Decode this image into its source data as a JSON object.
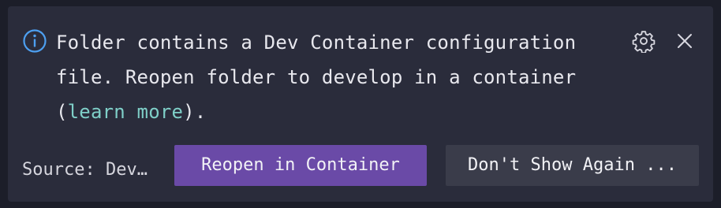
{
  "notification": {
    "message_before_link": "Folder contains a Dev Container configuration file. Reopen folder to develop in a container (",
    "link_text": "learn more",
    "message_after_link": ").",
    "source_label": "Source: Dev…",
    "primary_button_label": "Reopen in Container",
    "secondary_button_label": "Don't Show Again ...",
    "icons": {
      "info": "info-icon",
      "settings": "gear-icon",
      "close": "close-icon"
    }
  },
  "colors": {
    "background": "#1c1e29",
    "panel": "#2a2c3b",
    "info_icon": "#4d9ff0",
    "link": "#7fcfc8",
    "primary_button": "#6a4aa7",
    "secondary_button": "#3a3c4a",
    "text": "#e8e8ee"
  }
}
